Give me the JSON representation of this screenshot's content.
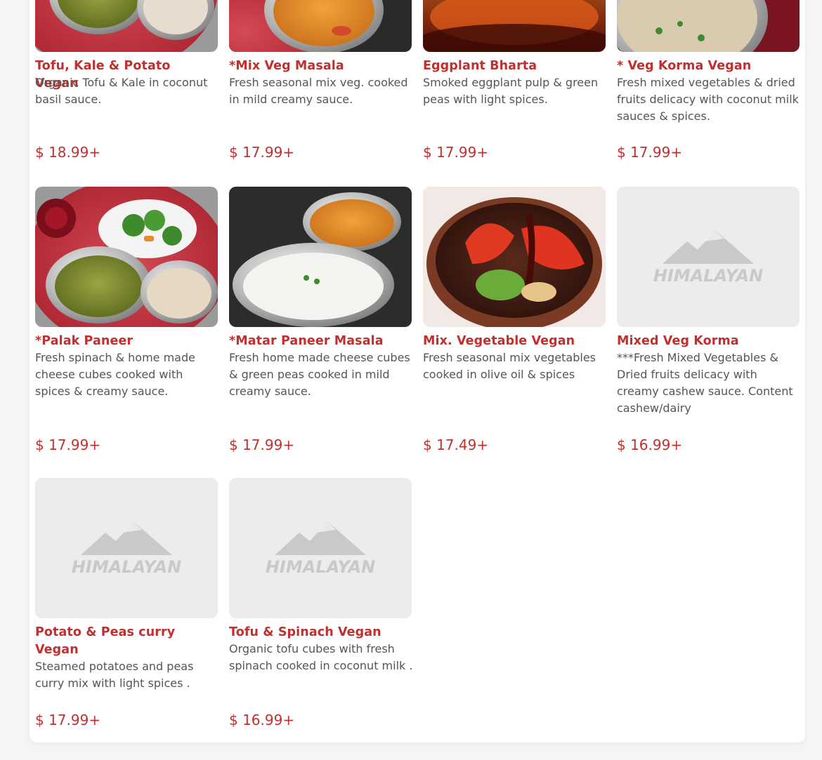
{
  "colors": {
    "accent": "#c0302e",
    "text": "#555555",
    "placeholder_bg": "#ececec"
  },
  "placeholder_logo_text": "HIMALAYAN",
  "items": [
    {
      "title": "Tofu, Kale & Potato Vegan",
      "description": "Organic Tofu & Kale in coconut basil sauce.",
      "price": "$ 18.99+"
    },
    {
      "title": "*Mix Veg Masala",
      "description": "Fresh seasonal mix veg. cooked in mild creamy sauce.",
      "price": "$ 17.99+"
    },
    {
      "title": "Eggplant Bharta",
      "description": "Smoked eggplant pulp & green peas with light spices.",
      "price": "$ 17.99+"
    },
    {
      "title": "* Veg Korma Vegan",
      "description": "Fresh mixed vegetables & dried fruits delicacy with coconut milk sauces & spices.",
      "price": "$ 17.99+"
    },
    {
      "title": "*Palak Paneer",
      "description": "Fresh spinach & home made cheese cubes cooked with spices & creamy sauce.",
      "price": "$ 17.99+"
    },
    {
      "title": "*Matar Paneer Masala",
      "description": "Fresh home made cheese cubes & green peas cooked in mild creamy sauce.",
      "price": "$ 17.99+"
    },
    {
      "title": "Mix. Vegetable Vegan",
      "description": "Fresh seasonal mix vegetables cooked in olive oil & spices",
      "price": "$ 17.49+"
    },
    {
      "title": "Mixed Veg Korma",
      "description": "***Fresh Mixed Vegetables & Dried fruits delicacy with creamy cashew sauce. Content cashew/dairy",
      "price": "$ 16.99+"
    },
    {
      "title": "Potato & Peas curry Vegan",
      "description": "Steamed potatoes and peas curry mix with light spices .",
      "price": "$ 17.99+"
    },
    {
      "title": "Tofu & Spinach Vegan",
      "description": "Organic tofu cubes with fresh spinach cooked in coconut milk .",
      "price": "$ 16.99+"
    }
  ]
}
